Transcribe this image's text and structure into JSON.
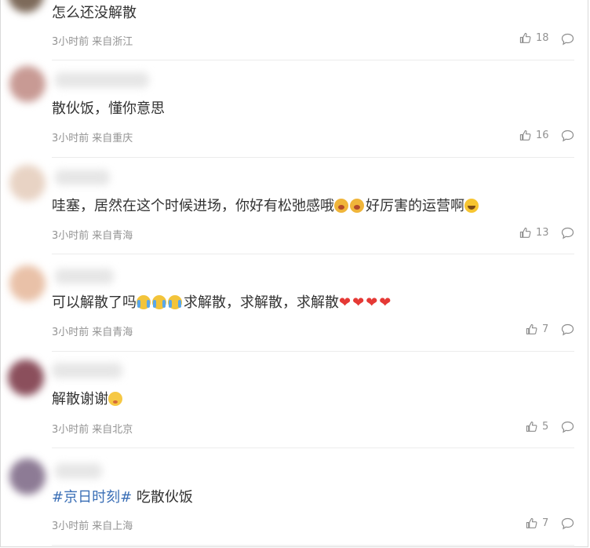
{
  "comments": [
    {
      "text": "怎么还没解散",
      "time": "3小时前",
      "location": "来自浙江",
      "likes": "18"
    },
    {
      "text": "散伙饭，懂你意思",
      "time": "3小时前",
      "location": "来自重庆",
      "likes": "16"
    },
    {
      "text_a": "哇塞，居然在这个时候进场，你好有松弛感哦",
      "text_b": "好厉害的运营啊",
      "time": "3小时前",
      "location": "来自青海",
      "likes": "13"
    },
    {
      "text_a": "可以解散了吗",
      "text_b": "求解散，求解散，求解散",
      "time": "3小时前",
      "location": "来自青海",
      "likes": "7"
    },
    {
      "text": "解散谢谢",
      "time": "3小时前",
      "location": "来自北京",
      "likes": "5"
    },
    {
      "hashtag": "#京日时刻#",
      "text": " 吃散伙饭",
      "time": "3小时前",
      "location": "来自上海",
      "likes": "7"
    }
  ],
  "icons": {
    "like": "thumbs-up-icon",
    "reply": "comment-bubble-icon",
    "emoji_laugh": "laughing-emoji",
    "emoji_sob": "sobbing-emoji",
    "emoji_cry": "crying-emoji",
    "emoji_shy": "shy-emoji",
    "heart": "heart-emoji"
  },
  "colors": {
    "text": "#333333",
    "meta": "#939393",
    "hashtag": "#3b6fb6",
    "divider": "#ececec",
    "heart": "#e53935"
  }
}
